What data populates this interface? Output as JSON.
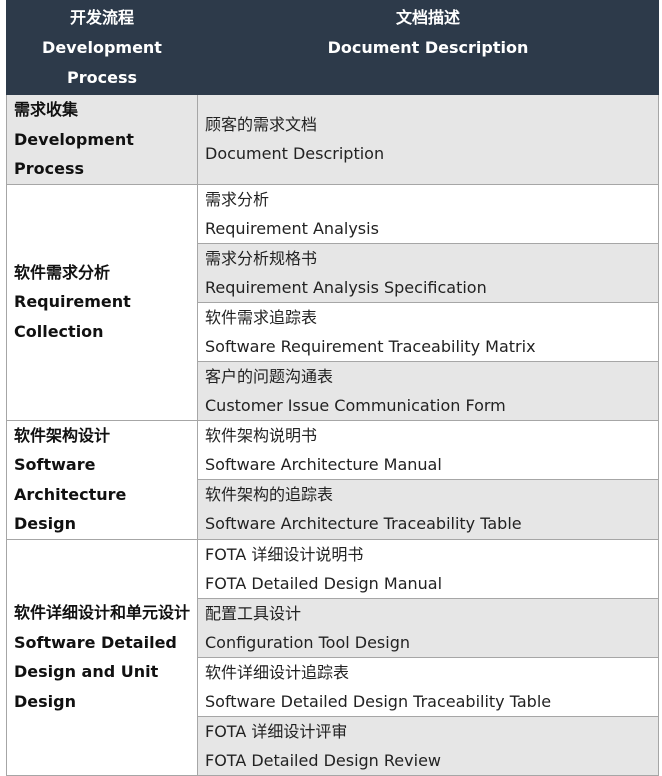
{
  "header": {
    "process_zh": "开发流程",
    "process_en_1": "Development",
    "process_en_2": "Process",
    "desc_zh": "文档描述",
    "desc_en": "Document Description"
  },
  "sections": [
    {
      "process_zh": "需求收集",
      "process_en_1": "Development",
      "process_en_2": "Process",
      "documents": [
        {
          "zh": "顾客的需求文档",
          "en": "Document Description"
        }
      ]
    },
    {
      "process_zh": "软件需求分析",
      "process_en_1": "Requirement",
      "process_en_2": "Collection",
      "documents": [
        {
          "zh": "需求分析",
          "en": "Requirement Analysis"
        },
        {
          "zh": "需求分析规格书",
          "en": "Requirement Analysis Specification"
        },
        {
          "zh": "软件需求追踪表",
          "en": "Software Requirement Traceability Matrix"
        },
        {
          "zh": "客户的问题沟通表",
          "en": "Customer Issue Communication Form"
        }
      ]
    },
    {
      "process_zh": "软件架构设计",
      "process_en_1": "Software",
      "process_en_2": "Architecture Design",
      "documents": [
        {
          "zh": "软件架构说明书",
          "en": "Software Architecture Manual"
        },
        {
          "zh": "软件架构的追踪表",
          "en": "Software Architecture Traceability Table"
        }
      ]
    },
    {
      "process_zh": "软件详细设计和单元设计",
      "process_en_1": "Software Detailed",
      "process_en_2": "Design and Unit",
      "process_en_3": "Design",
      "documents": [
        {
          "zh": "FOTA 详细设计说明书",
          "en": "FOTA Detailed Design Manual"
        },
        {
          "zh": "配置工具设计",
          "en": "Configuration Tool Design"
        },
        {
          "zh": "软件详细设计追踪表",
          "en": "Software Detailed Design Traceability Table"
        },
        {
          "zh": "FOTA 详细设计评审",
          "en": "FOTA Detailed Design Review"
        }
      ]
    }
  ]
}
